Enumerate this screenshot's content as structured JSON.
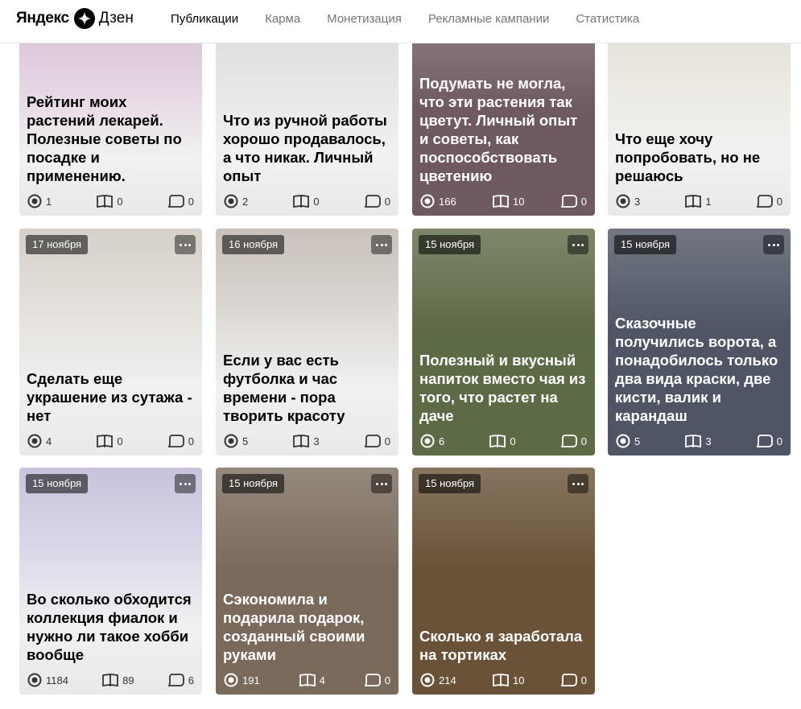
{
  "header": {
    "logo_text": "Яндекс",
    "logo_product": "Дзен",
    "nav": [
      "Публикации",
      "Карма",
      "Монетизация",
      "Рекламные кампании",
      "Статистика"
    ],
    "active_index": 0
  },
  "cards": [
    {
      "title": "Рейтинг моих растений лекарей. Полезные советы по посадке и применению.",
      "date": "",
      "views": "1",
      "reads": "0",
      "comments": "0",
      "theme": "light"
    },
    {
      "title": "Что из ручной работы хорошо продавалось, а что никак. Личный опыт",
      "date": "",
      "views": "2",
      "reads": "0",
      "comments": "0",
      "theme": "light"
    },
    {
      "title": "Подумать не могла, что эти растения так цветут. Личный опыт и советы, как поспособствовать цветению",
      "date": "",
      "views": "166",
      "reads": "10",
      "comments": "0",
      "theme": "dark"
    },
    {
      "title": "Что еще хочу попробовать, но не решаюсь",
      "date": "",
      "views": "3",
      "reads": "1",
      "comments": "0",
      "theme": "light"
    },
    {
      "title": "Сделать еще украшение из сутажа - нет",
      "date": "17 ноября",
      "views": "4",
      "reads": "0",
      "comments": "0",
      "theme": "light"
    },
    {
      "title": "Если у вас есть футболка и час времени - пора творить красоту",
      "date": "16 ноября",
      "views": "5",
      "reads": "3",
      "comments": "0",
      "theme": "light"
    },
    {
      "title": "Полезный и вкусный напиток вместо чая из того, что растет на даче",
      "date": "15 ноября",
      "views": "6",
      "reads": "0",
      "comments": "0",
      "theme": "dark"
    },
    {
      "title": "Сказочные получились ворота, а понадобилось только два вида краски, две кисти, валик и карандаш",
      "date": "15 ноября",
      "views": "5",
      "reads": "3",
      "comments": "0",
      "theme": "dark"
    },
    {
      "title": "Во сколько обходится коллекция фиалок и нужно ли такое хобби вообще",
      "date": "15 ноября",
      "views": "1184",
      "reads": "89",
      "comments": "6",
      "theme": "light"
    },
    {
      "title": "Сэкономила и подарила подарок, созданный своими руками",
      "date": "15 ноября",
      "views": "191",
      "reads": "4",
      "comments": "0",
      "theme": "dark"
    },
    {
      "title": "Сколько я заработала на тортиках",
      "date": "15 ноября",
      "views": "214",
      "reads": "10",
      "comments": "0",
      "theme": "dark"
    }
  ],
  "colors": {
    "card_backgrounds": [
      "#d9c3d6",
      "#dcdcdc",
      "#6e5a5e",
      "#e3e0d6",
      "#d6d0c8",
      "#c9c2bb",
      "#5d6a46",
      "#4f5564",
      "#c9c2dc",
      "#7a6a5c",
      "#6a5238"
    ]
  }
}
